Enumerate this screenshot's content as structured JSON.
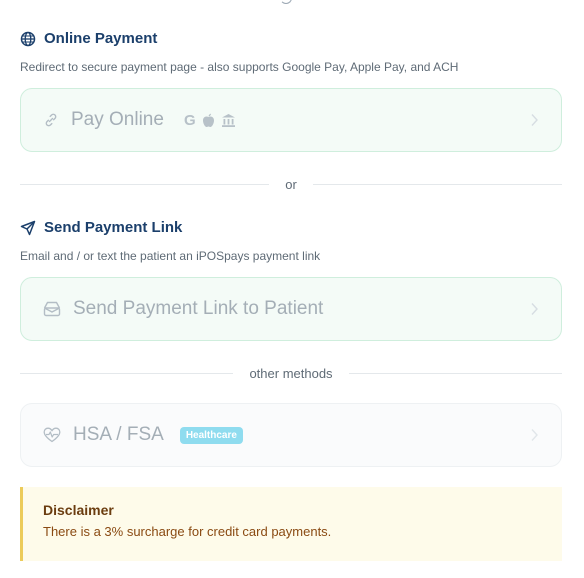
{
  "online_payment": {
    "title": "Online Payment",
    "description": "Redirect to secure payment page - also supports Google Pay, Apple Pay, and ACH",
    "button_label": "Pay Online",
    "brand_google": "G"
  },
  "divider_or": "or",
  "payment_link": {
    "title": "Send Payment Link",
    "description": "Email and / or text the patient an iPOSpays payment link",
    "button_label": "Send Payment Link to Patient"
  },
  "divider_other": "other methods",
  "hsa": {
    "button_label": "HSA / FSA",
    "badge": "Healthcare"
  },
  "disclaimer": {
    "title": "Disclaimer",
    "text": "There is a 3% surcharge for credit card payments."
  },
  "icons": {
    "online_payment": "globe-icon",
    "payment_link": "send-icon",
    "pay_online": "link-icon",
    "send_link": "mail-icon",
    "hsa": "heart-pulse-icon",
    "brands": [
      "google-icon",
      "apple-icon",
      "bank-icon"
    ],
    "chevron": "chevron-right-icon"
  },
  "colors": {
    "title": "#1b3f6b",
    "button_border": "#cfeedd",
    "button_fill": "#f4fbf7",
    "badge": "#8fdcef",
    "disclaimer_bg": "#fefbea",
    "disclaimer_border": "#eccb5a",
    "disclaimer_text": "#8a4a12"
  }
}
